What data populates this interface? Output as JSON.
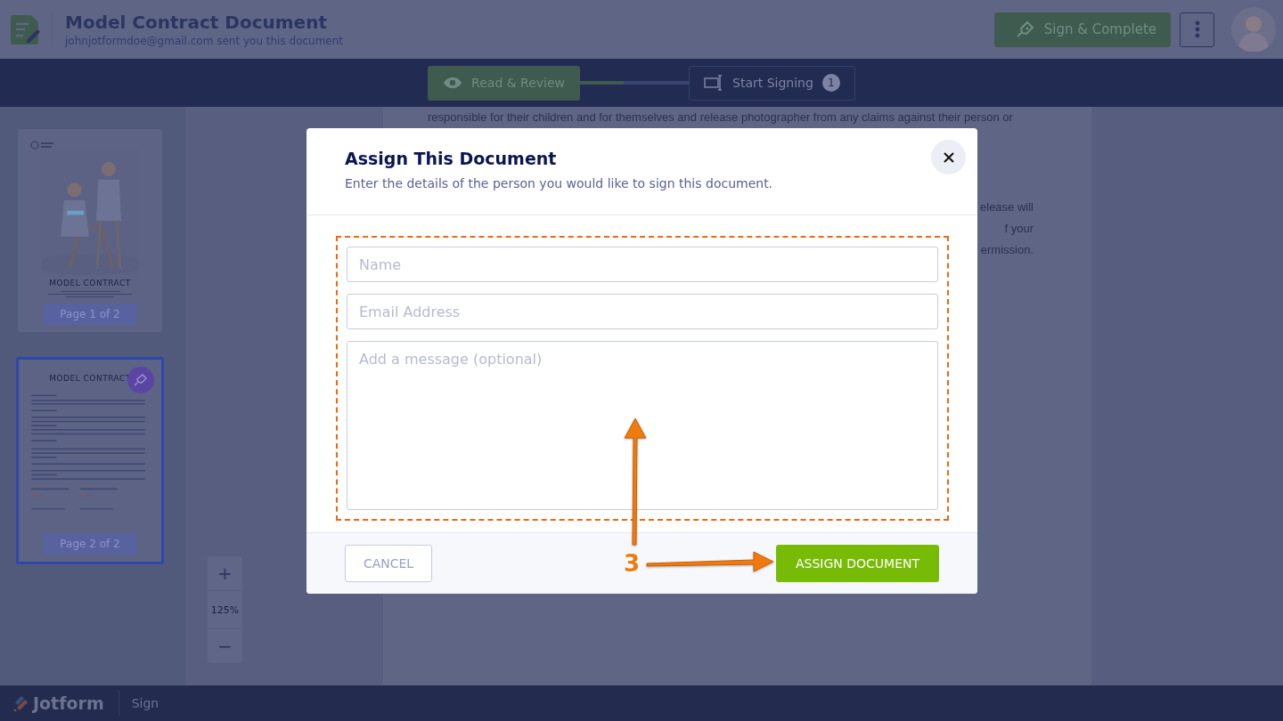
{
  "header": {
    "title": "Model Contract Document",
    "subtitle": "johnjotformdoe@gmail.com sent you this document",
    "primary_button": "Sign & Complete"
  },
  "steps": [
    {
      "label": "Read & Review",
      "selected": true
    },
    {
      "label": "Start Signing",
      "badge": "1",
      "selected": false
    }
  ],
  "step_connector": {
    "level": 0.4
  },
  "thumbnails": [
    {
      "kind": "cover",
      "title": "MODEL CONTRACT",
      "label": "Page 1 of 2",
      "selected": false
    },
    {
      "kind": "text",
      "title": "MODEL CONTRACT",
      "label": "Page 2 of 2",
      "selected": true
    }
  ],
  "zoom": {
    "zoom_in": "+",
    "value": "125%",
    "zoom_out": "−"
  },
  "document": {
    "first_line": "responsible for their children and for themselves and release photographer from any claims against their person or",
    "partial_lines": [
      "elease will",
      "f your",
      "ermission."
    ]
  },
  "dialog": {
    "title": "Assign This Document",
    "subtitle": "Enter the details of the person you would like to sign this document.",
    "fields": [
      {
        "kind": "line",
        "placeholder": "Name"
      },
      {
        "kind": "line",
        "placeholder": "Email Address"
      },
      {
        "kind": "area",
        "placeholder": "Add a message (optional)"
      }
    ],
    "cancel": "CANCEL",
    "submit": "ASSIGN DOCUMENT"
  },
  "annotation": {
    "number": "3"
  },
  "footer": {
    "brand": "Jotform",
    "section": "Sign"
  }
}
